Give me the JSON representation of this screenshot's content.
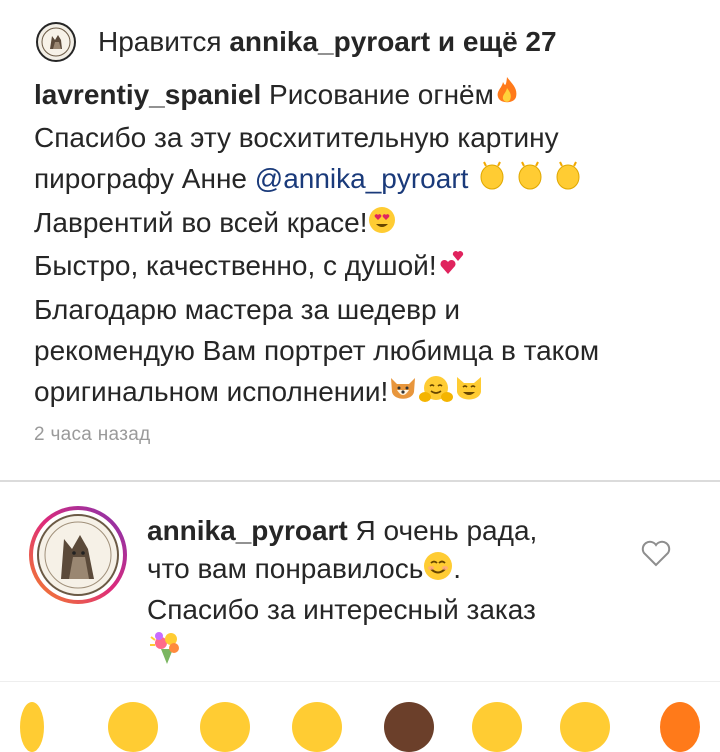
{
  "likes": {
    "prefix": "Нравится",
    "user": "annika_pyroart",
    "suffix": "и ещё 27"
  },
  "post": {
    "username": "lavrentiy_spaniel",
    "line1": "Рисование огнём",
    "line2": "Спасибо за эту восхитительную картину",
    "line3": "пирографу Анне",
    "mention": "@annika_pyroart",
    "line4": "Лаврентий во всей красе!",
    "line5": "Быстро, качественно, с душой!",
    "line6": "Благодарю мастера за шедевр и",
    "line7": "рекомендую Вам портрет любимца в таком",
    "line8": "оригинальном исполнении!",
    "time": "2 часа назад"
  },
  "reply": {
    "username": "annika_pyroart",
    "line1": "Я очень рада,",
    "line2": "что вам понравилось",
    "line2_end": ".",
    "line3": "Спасибо за интересный заказ"
  },
  "icons": {
    "fire": "fire-icon",
    "clap": "clapping-hands-icon",
    "heart_eyes": "heart-eyes-icon",
    "two_hearts": "two-hearts-icon",
    "dog": "dog-face-icon",
    "hug": "hugging-face-icon",
    "cat": "smiling-cat-icon",
    "smile": "smiling-face-icon",
    "bouquet": "bouquet-icon",
    "like": "heart-outline-icon"
  },
  "colors": {
    "text": "#262626",
    "mention": "#1a3a7a",
    "muted": "#9a9a9a",
    "divider": "#dbdbdb",
    "story_ring": "#c13584"
  }
}
